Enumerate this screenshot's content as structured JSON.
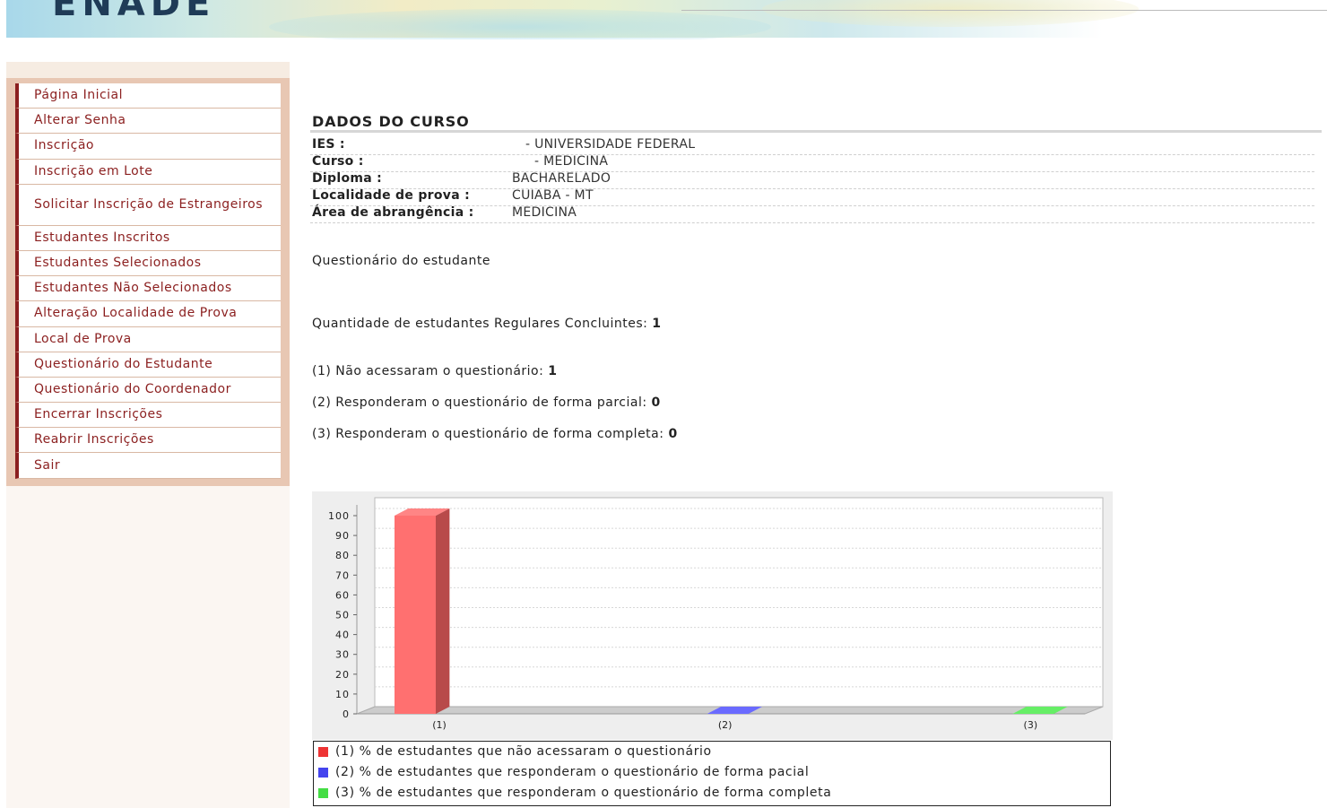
{
  "header": {
    "logo_text": "ENADE"
  },
  "sidebar": {
    "items": [
      {
        "label": "Página Inicial"
      },
      {
        "label": "Alterar Senha"
      },
      {
        "label": "Inscrição"
      },
      {
        "label": "Inscrição em Lote"
      },
      {
        "label": "Solicitar Inscrição de Estrangeiros"
      },
      {
        "label": "Estudantes Inscritos"
      },
      {
        "label": "Estudantes Selecionados"
      },
      {
        "label": "Estudantes Não Selecionados"
      },
      {
        "label": "Alteração Localidade de Prova"
      },
      {
        "label": "Local de Prova"
      },
      {
        "label": "Questionário do Estudante"
      },
      {
        "label": "Questionário do Coordenador"
      },
      {
        "label": "Encerrar Inscrições"
      },
      {
        "label": "Reabrir Inscrições"
      },
      {
        "label": "Sair"
      }
    ]
  },
  "course": {
    "section_title": "DADOS DO CURSO",
    "rows": [
      {
        "label": "IES :",
        "value": "- UNIVERSIDADE FEDERAL"
      },
      {
        "label": "Curso :",
        "value": "- MEDICINA"
      },
      {
        "label": "Diploma :",
        "value": "BACHARELADO"
      },
      {
        "label": "Localidade de prova :",
        "value": "CUIABA - MT"
      },
      {
        "label": "Área de abrangência :",
        "value": "MEDICINA"
      }
    ]
  },
  "questionnaire": {
    "heading": "Questionário do estudante",
    "total_label": "Quantidade de estudantes Regulares Concluintes:",
    "total_value": "1",
    "stats": [
      {
        "label": "(1) Não acessaram o questionário:",
        "value": "1"
      },
      {
        "label": "(2) Responderam o questionário de forma parcial:",
        "value": "0"
      },
      {
        "label": "(3) Responderam o questionário de forma completa:",
        "value": "0"
      }
    ]
  },
  "chart_data": {
    "type": "bar",
    "categories": [
      "(1)",
      "(2)",
      "(3)"
    ],
    "values": [
      100,
      0,
      0
    ],
    "colors": [
      "#ff7070",
      "#6a6aff",
      "#66ee66"
    ],
    "ylim": [
      0,
      100
    ],
    "yticks": [
      "0",
      "10",
      "20",
      "30",
      "40",
      "50",
      "60",
      "70",
      "80",
      "90",
      "100"
    ],
    "grid": true,
    "legend": [
      "(1) % de estudantes que não acessaram o questionário",
      "(2) % de estudantes que responderam o questionário de forma pacial",
      "(3) % de estudantes que responderam o questionário de forma completa"
    ],
    "legend_position": "bottom"
  }
}
